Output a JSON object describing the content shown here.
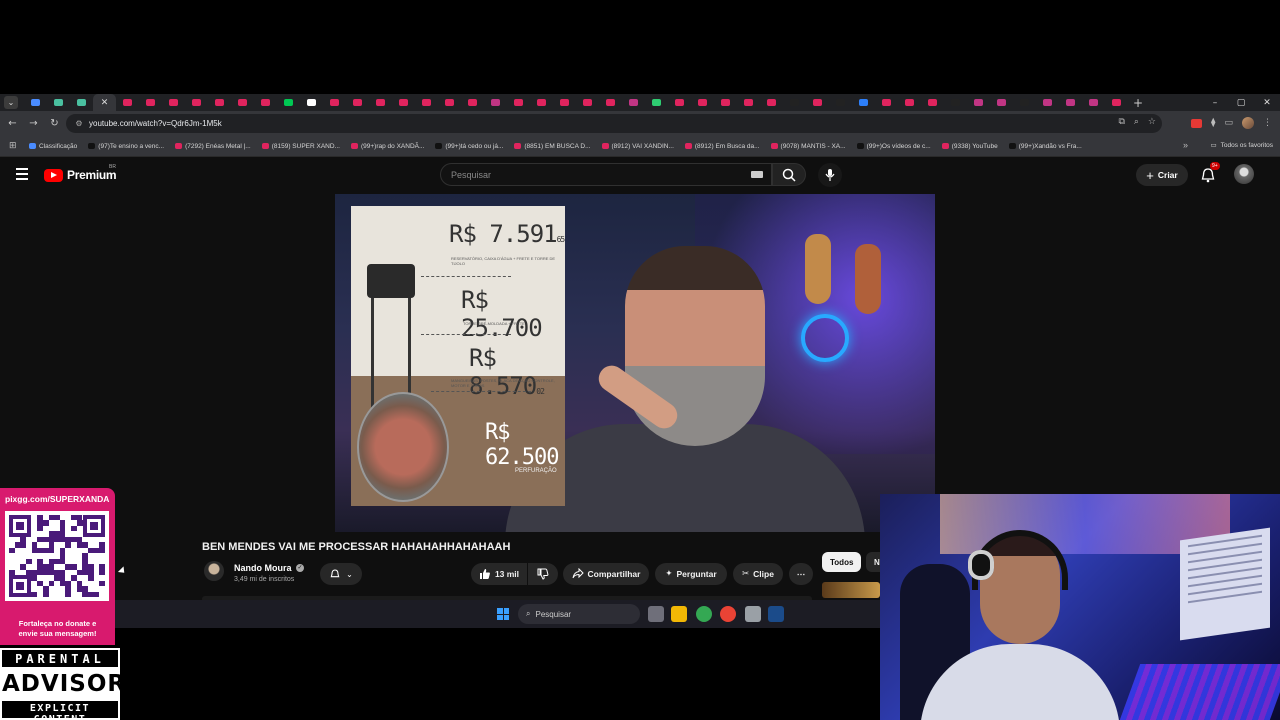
{
  "browser": {
    "tab_favicons": [
      "#4a8cff",
      "#4ac0a0",
      "#4ac0a0",
      "close",
      "#e0245e",
      "#e0245e",
      "#e0245e",
      "#e0245e",
      "#e0245e",
      "#e0245e",
      "#e0245e",
      "#00c853",
      "#ffffff",
      "#e0245e",
      "#e0245e",
      "#e0245e",
      "#e0245e",
      "#e0245e",
      "#e0245e",
      "#e0245e",
      "#c13584",
      "#e0245e",
      "#e0245e",
      "#e0245e",
      "#e0245e",
      "#e0245e",
      "#c13584",
      "#2ecc71",
      "#e0245e",
      "#e0245e",
      "#e0245e",
      "#e0245e",
      "#e0245e",
      "#222222",
      "#e0245e",
      "#222222",
      "#2d7ff9",
      "#e0245e",
      "#e0245e",
      "#e0245e",
      "#222222",
      "#c13584",
      "#c13584",
      "#222222",
      "#c13584",
      "#c13584",
      "#c13584",
      "#e0245e"
    ],
    "url": "youtube.com/watch?v=Qdr6Jm-1M5k",
    "bookmarks": [
      {
        "label": "Classificação",
        "color": "#4a8cff"
      },
      {
        "label": "(97)Te ensino a venc...",
        "color": "#111111"
      },
      {
        "label": "(7292) Enéas Metal |...",
        "color": "#e0245e"
      },
      {
        "label": "(8159) SUPER XAND...",
        "color": "#e0245e"
      },
      {
        "label": "(99+)rap do XANDÃ...",
        "color": "#e0245e"
      },
      {
        "label": "(99+)tá cedo ou já...",
        "color": "#111111"
      },
      {
        "label": "(8851) EM BUSCA D...",
        "color": "#e0245e"
      },
      {
        "label": "(8912) VAI XANDIN...",
        "color": "#e0245e"
      },
      {
        "label": "(8912) Em Busca da...",
        "color": "#e0245e"
      },
      {
        "label": "(9078) MANTIS - XA...",
        "color": "#e0245e"
      },
      {
        "label": "(99+)Os vídeos de c...",
        "color": "#111111"
      },
      {
        "label": "(9338) YouTube",
        "color": "#e0245e"
      },
      {
        "label": "(99+)Xandão vs Fra...",
        "color": "#111111"
      }
    ],
    "all_bookmarks_label": "Todos os favoritos"
  },
  "youtube": {
    "brand": "Premium",
    "region": "BR",
    "search_placeholder": "Pesquisar",
    "create_label": "Criar",
    "notification_count": "9+",
    "video_title": "BEN MENDES VAI ME PROCESSAR HAHAHAHHAHAHAAH",
    "channel_name": "Nando Moura",
    "subscribers": "3,49 mi de inscritos",
    "likes": "13 mil",
    "share_label": "Compartilhar",
    "ask_label": "Perguntar",
    "clip_label": "Clipe",
    "chip_all": "Todos",
    "chip_next": "N",
    "thumbnail_prices": [
      {
        "main": "R$ 7.591",
        "cents": "65",
        "caption": "RESERVATÓRIO, CAIXA D'ÁGUA + FRETE E TORRE DE TIJOLO"
      },
      {
        "main": "R$ 25.700",
        "cents": "",
        "caption": "TORRE PRÉ-MOLDADA + FRETE"
      },
      {
        "main": "R$ 8.570",
        "cents": "02",
        "caption": "MANGUEIRAS, POSTES, PLACA DE AÇÃO CONTROLE, MOTOR E TUBOS"
      },
      {
        "main": "R$ 62.500",
        "cents": "",
        "caption": "PERFURAÇÃO"
      }
    ]
  },
  "taskbar": {
    "search_placeholder": "Pesquisar",
    "apps": [
      {
        "name": "task-view-icon",
        "color": "#6f6f7a"
      },
      {
        "name": "file-explorer-icon",
        "color": "#f2b705"
      },
      {
        "name": "chrome-icon",
        "color": "#34a853"
      },
      {
        "name": "chrome-alt-icon",
        "color": "#ea4335"
      },
      {
        "name": "settings-icon",
        "color": "#9aa0a6"
      },
      {
        "name": "steam-icon",
        "color": "#1b4b8a"
      }
    ]
  },
  "overlay": {
    "donation_url": "pixgg.com/SUPERXANDA",
    "donation_message_line1": "Fortaleça no donate e",
    "donation_message_line2": "envie sua mensagem!",
    "advisory_top": "PARENTAL",
    "advisory_mid": "ADVISORY",
    "advisory_bottom": "EXPLICIT CONTENT"
  }
}
